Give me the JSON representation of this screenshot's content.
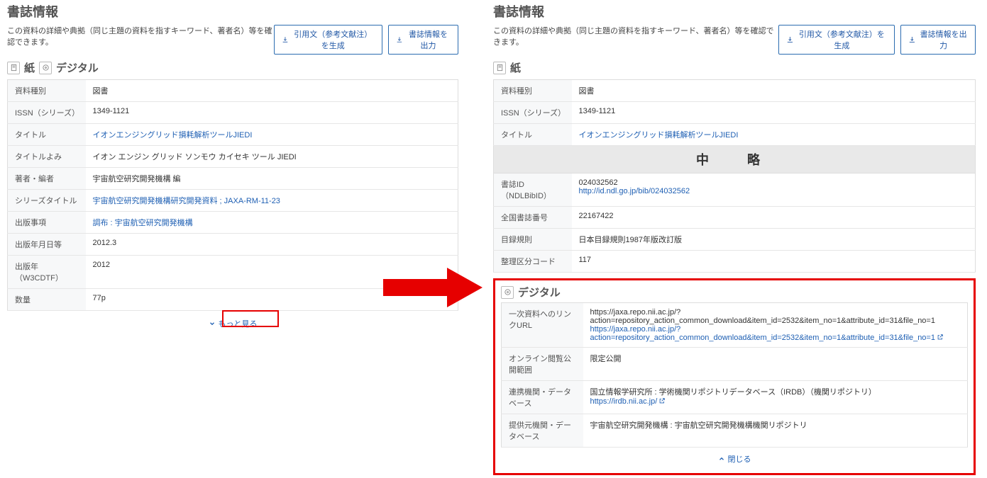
{
  "common": {
    "heading": "書誌情報",
    "subtitle": "この資料の詳細や典拠（同じ主題の資料を指すキーワード、著者名）等を確認できます。",
    "btn_citation": "引用文（参考文献注）を生成",
    "btn_export": "書誌情報を出力"
  },
  "left": {
    "section_paper": "紙",
    "section_digital": "デジタル",
    "rows": [
      {
        "label": "資料種別",
        "value": "図書"
      },
      {
        "label": "ISSN（シリーズ）",
        "value": "1349-1121"
      },
      {
        "label": "タイトル",
        "value": "イオンエンジングリッド損耗解析ツールJIEDI",
        "link": true
      },
      {
        "label": "タイトルよみ",
        "value": "イオン エンジン グリッド ソンモウ カイセキ ツール JIEDI"
      },
      {
        "label": "著者・編者",
        "value": "宇宙航空研究開発機構 編"
      },
      {
        "label": "シリーズタイトル",
        "value": "宇宙航空研究開発機構研究開発資料 ; JAXA-RM-11-23",
        "link": true
      },
      {
        "label": "出版事項",
        "value": "調布 : 宇宙航空研究開発機構",
        "link": true
      },
      {
        "label": "出版年月日等",
        "value": "2012.3"
      },
      {
        "label": "出版年（W3CDTF）",
        "value": "2012"
      },
      {
        "label": "数量",
        "value": "77p"
      }
    ],
    "more": "もっと見る"
  },
  "right": {
    "section_paper": "紙",
    "top_rows": [
      {
        "label": "資料種別",
        "value": "図書"
      },
      {
        "label": "ISSN（シリーズ）",
        "value": "1349-1121"
      },
      {
        "label": "タイトル",
        "value": "イオンエンジングリッド損耗解析ツールJIEDI",
        "link": true
      }
    ],
    "omitted": "中　略",
    "mid_rows": [
      {
        "label": "書誌ID（NDLBibID）",
        "value": "024032562",
        "link_below": "http://id.ndl.go.jp/bib/024032562"
      },
      {
        "label": "全国書誌番号",
        "value": "22167422"
      },
      {
        "label": "目録規則",
        "value": "日本目録規則1987年版改訂版"
      },
      {
        "label": "整理区分コード",
        "value": "117"
      }
    ],
    "section_digital": "デジタル",
    "digital_rows": [
      {
        "label": "一次資料へのリンクURL",
        "value": "https://jaxa.repo.nii.ac.jp/?action=repository_action_common_download&item_id=2532&item_no=1&attribute_id=31&file_no=1",
        "link_below": "https://jaxa.repo.nii.ac.jp/?action=repository_action_common_download&item_id=2532&item_no=1&attribute_id=31&file_no=1",
        "ext": true
      },
      {
        "label": "オンライン閲覧公開範囲",
        "value": "限定公開"
      },
      {
        "label": "連携機関・データベース",
        "value": "国立情報学研究所 : 学術機関リポジトリデータベース（IRDB）（機関リポジトリ）",
        "link_below": "https://irdb.nii.ac.jp/",
        "ext": true
      },
      {
        "label": "提供元機関・データベース",
        "value": "宇宙航空研究開発機構 : 宇宙航空研究開発機構機関リポジトリ"
      }
    ],
    "close": "閉じる"
  }
}
